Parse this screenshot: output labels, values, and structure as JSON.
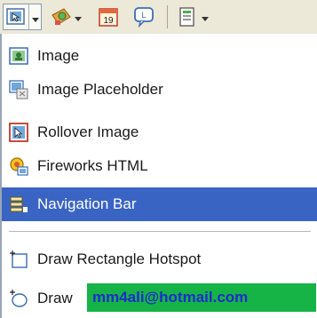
{
  "toolbar": {
    "icons": [
      "image-icon",
      "chevron-down-icon",
      "asset-icon",
      "calendar-icon",
      "comment-icon",
      "template-icon"
    ],
    "calendar_day": "19"
  },
  "menu": {
    "items": [
      {
        "label": "Image",
        "icon": "image-icon"
      },
      {
        "label": "Image Placeholder",
        "icon": "image-placeholder-icon"
      },
      {
        "label": "Rollover Image",
        "icon": "rollover-image-icon"
      },
      {
        "label": "Fireworks HTML",
        "icon": "fireworks-html-icon"
      },
      {
        "label": "Navigation Bar",
        "icon": "navigation-bar-icon",
        "highlighted": true
      },
      {
        "label": "Draw Rectangle Hotspot",
        "icon": "rectangle-hotspot-icon"
      },
      {
        "label": "Draw",
        "icon": "oval-hotspot-icon"
      }
    ]
  },
  "watermark": {
    "text": "mm4ali@hotmail.com"
  },
  "colors": {
    "highlight": "#3a64c4",
    "toolbar_bg": "#ece9d8",
    "watermark_bg": "#16b446",
    "watermark_text": "#1d2bd0"
  }
}
